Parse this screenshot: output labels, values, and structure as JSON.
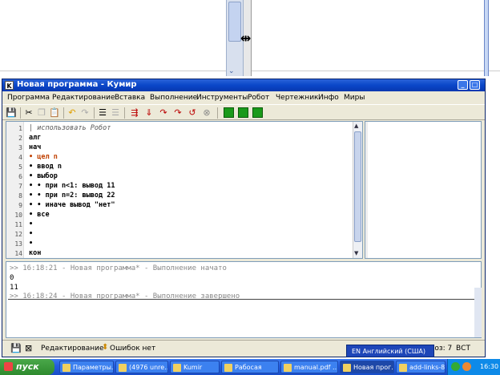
{
  "window": {
    "app_letter": "K",
    "title": "Новая программа - Кумир"
  },
  "menu": [
    "Программа",
    "Редактирование",
    "Вставка",
    "Выполнение",
    "Инструменты",
    "Робот",
    "Чертежник",
    "Инфо",
    "Миры"
  ],
  "editor": {
    "lines": [
      {
        "n": "1",
        "text": "| использовать Робот",
        "style": "comment"
      },
      {
        "n": "2",
        "text": "алг"
      },
      {
        "n": "3",
        "text": "нач"
      },
      {
        "n": "4",
        "text": "• цел n"
      },
      {
        "n": "5",
        "text": "• ввод n"
      },
      {
        "n": "6",
        "text": "• выбор"
      },
      {
        "n": "7",
        "text": "• • при n<1: вывод 11"
      },
      {
        "n": "8",
        "text": "• • при n=2: вывод 22"
      },
      {
        "n": "9",
        "text": "• • иначе вывод \"нет\""
      },
      {
        "n": "10",
        "text": "• все"
      },
      {
        "n": "11",
        "text": "•"
      },
      {
        "n": "12",
        "text": "•"
      },
      {
        "n": "13",
        "text": "•"
      },
      {
        "n": "14",
        "text": "кон"
      }
    ]
  },
  "output": {
    "lines": [
      {
        "text": ">> 16:18:21 - Новая программа* - Выполнение начато",
        "kind": "msg"
      },
      {
        "text": "0",
        "kind": "value"
      },
      {
        "text": "11",
        "kind": "value"
      },
      {
        "text": ">> 16:18:24 - Новая программа* - Выполнение завершено",
        "kind": "msg"
      }
    ]
  },
  "status": {
    "mode": "Редактирование",
    "errors": "Ошибок нет",
    "position": "Стр: 6, Поз: 7",
    "insert_mode": "ВСТ"
  },
  "language_bar": "EN Английский (США)",
  "taskbar": {
    "start_label": "пуск",
    "tasks": [
      "Параметры...",
      "(4976 unre...",
      "Kumir",
      "Рабосая",
      "manual.pdf ...",
      "Новая прог...",
      "add-links-8-..."
    ],
    "clock": "16:30"
  },
  "colors": {
    "titlebar": "#0a46c8",
    "taskbar": "#245ee0",
    "keyword_color": "#000000",
    "number_color": "#1a6adc",
    "string_color": "#1a6adc",
    "type_color": "#c04000"
  }
}
